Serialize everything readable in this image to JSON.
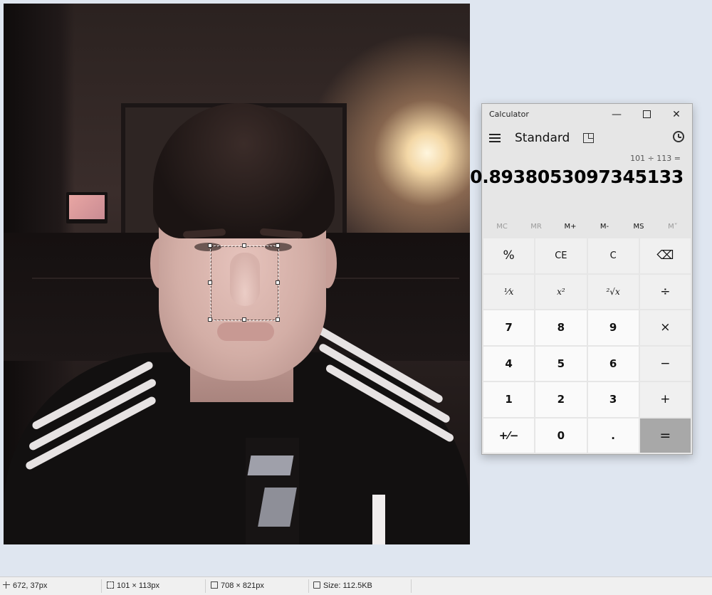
{
  "calculator": {
    "window_title": "Calculator",
    "controls": {
      "minimize": "—",
      "close": "✕"
    },
    "mode": "Standard",
    "expression": "101 ÷ 113 =",
    "result": "0.8938053097345133",
    "memory": [
      {
        "label": "MC",
        "enabled": false
      },
      {
        "label": "MR",
        "enabled": false
      },
      {
        "label": "M+",
        "enabled": true
      },
      {
        "label": "M-",
        "enabled": true
      },
      {
        "label": "MS",
        "enabled": true
      },
      {
        "label": "M˅",
        "enabled": false
      }
    ],
    "keys": [
      {
        "label": "%",
        "name": "percent-key",
        "kind": "op"
      },
      {
        "label": "CE",
        "name": "clear-entry-key",
        "kind": "fn"
      },
      {
        "label": "C",
        "name": "clear-key",
        "kind": "fn"
      },
      {
        "label": "⌫",
        "name": "backspace-key",
        "kind": "op"
      },
      {
        "label": "¹⁄x",
        "name": "reciprocal-key",
        "kind": "func"
      },
      {
        "label": "x²",
        "name": "square-key",
        "kind": "func"
      },
      {
        "label": "²√x",
        "name": "square-root-key",
        "kind": "func"
      },
      {
        "label": "÷",
        "name": "divide-key",
        "kind": "op"
      },
      {
        "label": "7",
        "name": "digit-7-key",
        "kind": "num"
      },
      {
        "label": "8",
        "name": "digit-8-key",
        "kind": "num"
      },
      {
        "label": "9",
        "name": "digit-9-key",
        "kind": "num"
      },
      {
        "label": "×",
        "name": "multiply-key",
        "kind": "op"
      },
      {
        "label": "4",
        "name": "digit-4-key",
        "kind": "num"
      },
      {
        "label": "5",
        "name": "digit-5-key",
        "kind": "num"
      },
      {
        "label": "6",
        "name": "digit-6-key",
        "kind": "num"
      },
      {
        "label": "−",
        "name": "subtract-key",
        "kind": "op"
      },
      {
        "label": "1",
        "name": "digit-1-key",
        "kind": "num"
      },
      {
        "label": "2",
        "name": "digit-2-key",
        "kind": "num"
      },
      {
        "label": "3",
        "name": "digit-3-key",
        "kind": "num"
      },
      {
        "label": "+",
        "name": "add-key",
        "kind": "op"
      },
      {
        "label": "+⁄−",
        "name": "negate-key",
        "kind": "num"
      },
      {
        "label": "0",
        "name": "digit-0-key",
        "kind": "num"
      },
      {
        "label": ".",
        "name": "decimal-key",
        "kind": "num"
      },
      {
        "label": "=",
        "name": "equals-key",
        "kind": "eq"
      }
    ]
  },
  "status_bar": {
    "cursor_position": "672, 37px",
    "selection_size": "101 × 113px",
    "image_dimensions": "708 × 821px",
    "file_size": "Size: 112.5KB"
  },
  "colors": {
    "desktop_bg": "#dfe6f0",
    "calc_bg": "#e6e6e6",
    "equals_key": "#a8a8a8"
  }
}
